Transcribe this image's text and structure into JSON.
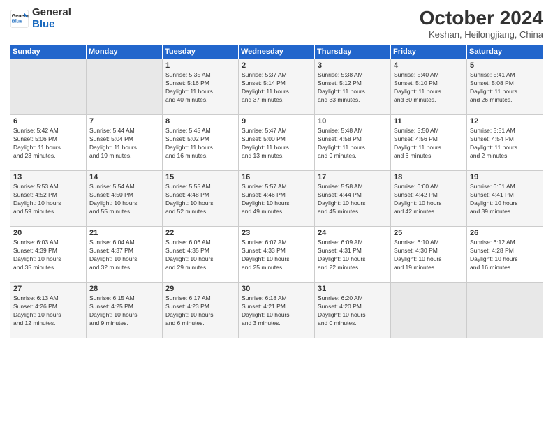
{
  "header": {
    "logo_line1": "General",
    "logo_line2": "Blue",
    "month": "October 2024",
    "location": "Keshan, Heilongjiang, China"
  },
  "weekdays": [
    "Sunday",
    "Monday",
    "Tuesday",
    "Wednesday",
    "Thursday",
    "Friday",
    "Saturday"
  ],
  "weeks": [
    [
      {
        "day": "",
        "info": ""
      },
      {
        "day": "",
        "info": ""
      },
      {
        "day": "1",
        "info": "Sunrise: 5:35 AM\nSunset: 5:16 PM\nDaylight: 11 hours\nand 40 minutes."
      },
      {
        "day": "2",
        "info": "Sunrise: 5:37 AM\nSunset: 5:14 PM\nDaylight: 11 hours\nand 37 minutes."
      },
      {
        "day": "3",
        "info": "Sunrise: 5:38 AM\nSunset: 5:12 PM\nDaylight: 11 hours\nand 33 minutes."
      },
      {
        "day": "4",
        "info": "Sunrise: 5:40 AM\nSunset: 5:10 PM\nDaylight: 11 hours\nand 30 minutes."
      },
      {
        "day": "5",
        "info": "Sunrise: 5:41 AM\nSunset: 5:08 PM\nDaylight: 11 hours\nand 26 minutes."
      }
    ],
    [
      {
        "day": "6",
        "info": "Sunrise: 5:42 AM\nSunset: 5:06 PM\nDaylight: 11 hours\nand 23 minutes."
      },
      {
        "day": "7",
        "info": "Sunrise: 5:44 AM\nSunset: 5:04 PM\nDaylight: 11 hours\nand 19 minutes."
      },
      {
        "day": "8",
        "info": "Sunrise: 5:45 AM\nSunset: 5:02 PM\nDaylight: 11 hours\nand 16 minutes."
      },
      {
        "day": "9",
        "info": "Sunrise: 5:47 AM\nSunset: 5:00 PM\nDaylight: 11 hours\nand 13 minutes."
      },
      {
        "day": "10",
        "info": "Sunrise: 5:48 AM\nSunset: 4:58 PM\nDaylight: 11 hours\nand 9 minutes."
      },
      {
        "day": "11",
        "info": "Sunrise: 5:50 AM\nSunset: 4:56 PM\nDaylight: 11 hours\nand 6 minutes."
      },
      {
        "day": "12",
        "info": "Sunrise: 5:51 AM\nSunset: 4:54 PM\nDaylight: 11 hours\nand 2 minutes."
      }
    ],
    [
      {
        "day": "13",
        "info": "Sunrise: 5:53 AM\nSunset: 4:52 PM\nDaylight: 10 hours\nand 59 minutes."
      },
      {
        "day": "14",
        "info": "Sunrise: 5:54 AM\nSunset: 4:50 PM\nDaylight: 10 hours\nand 55 minutes."
      },
      {
        "day": "15",
        "info": "Sunrise: 5:55 AM\nSunset: 4:48 PM\nDaylight: 10 hours\nand 52 minutes."
      },
      {
        "day": "16",
        "info": "Sunrise: 5:57 AM\nSunset: 4:46 PM\nDaylight: 10 hours\nand 49 minutes."
      },
      {
        "day": "17",
        "info": "Sunrise: 5:58 AM\nSunset: 4:44 PM\nDaylight: 10 hours\nand 45 minutes."
      },
      {
        "day": "18",
        "info": "Sunrise: 6:00 AM\nSunset: 4:42 PM\nDaylight: 10 hours\nand 42 minutes."
      },
      {
        "day": "19",
        "info": "Sunrise: 6:01 AM\nSunset: 4:41 PM\nDaylight: 10 hours\nand 39 minutes."
      }
    ],
    [
      {
        "day": "20",
        "info": "Sunrise: 6:03 AM\nSunset: 4:39 PM\nDaylight: 10 hours\nand 35 minutes."
      },
      {
        "day": "21",
        "info": "Sunrise: 6:04 AM\nSunset: 4:37 PM\nDaylight: 10 hours\nand 32 minutes."
      },
      {
        "day": "22",
        "info": "Sunrise: 6:06 AM\nSunset: 4:35 PM\nDaylight: 10 hours\nand 29 minutes."
      },
      {
        "day": "23",
        "info": "Sunrise: 6:07 AM\nSunset: 4:33 PM\nDaylight: 10 hours\nand 25 minutes."
      },
      {
        "day": "24",
        "info": "Sunrise: 6:09 AM\nSunset: 4:31 PM\nDaylight: 10 hours\nand 22 minutes."
      },
      {
        "day": "25",
        "info": "Sunrise: 6:10 AM\nSunset: 4:30 PM\nDaylight: 10 hours\nand 19 minutes."
      },
      {
        "day": "26",
        "info": "Sunrise: 6:12 AM\nSunset: 4:28 PM\nDaylight: 10 hours\nand 16 minutes."
      }
    ],
    [
      {
        "day": "27",
        "info": "Sunrise: 6:13 AM\nSunset: 4:26 PM\nDaylight: 10 hours\nand 12 minutes."
      },
      {
        "day": "28",
        "info": "Sunrise: 6:15 AM\nSunset: 4:25 PM\nDaylight: 10 hours\nand 9 minutes."
      },
      {
        "day": "29",
        "info": "Sunrise: 6:17 AM\nSunset: 4:23 PM\nDaylight: 10 hours\nand 6 minutes."
      },
      {
        "day": "30",
        "info": "Sunrise: 6:18 AM\nSunset: 4:21 PM\nDaylight: 10 hours\nand 3 minutes."
      },
      {
        "day": "31",
        "info": "Sunrise: 6:20 AM\nSunset: 4:20 PM\nDaylight: 10 hours\nand 0 minutes."
      },
      {
        "day": "",
        "info": ""
      },
      {
        "day": "",
        "info": ""
      }
    ]
  ]
}
